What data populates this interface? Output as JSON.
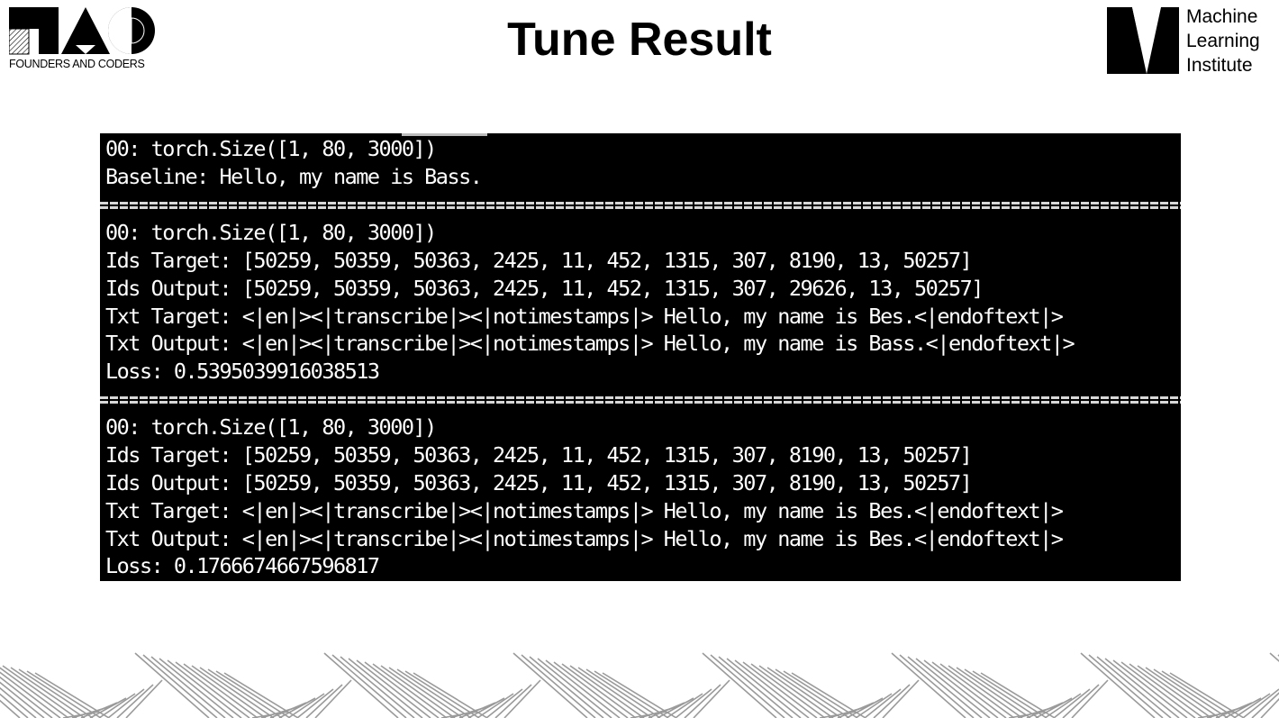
{
  "header": {
    "title": "Tune Result",
    "left_logo_text": "FOUNDERS AND CODERS",
    "right_logo_lines": [
      "Machine",
      "Learning",
      "Institute"
    ]
  },
  "terminal": {
    "blocks": [
      {
        "lines": [
          "00: torch.Size([1, 80, 3000])",
          "Baseline: Hello, my name is Bass."
        ]
      },
      {
        "lines": [
          "00: torch.Size([1, 80, 3000])",
          "Ids Target: [50259, 50359, 50363, 2425, 11, 452, 1315, 307, 8190, 13, 50257]",
          "Ids Output: [50259, 50359, 50363, 2425, 11, 452, 1315, 307, 29626, 13, 50257]",
          "Txt Target: <|en|><|transcribe|><|notimestamps|> Hello, my name is Bes.<|endoftext|>",
          "Txt Output: <|en|><|transcribe|><|notimestamps|> Hello, my name is Bass.<|endoftext|>",
          "Loss: 0.5395039916038513"
        ]
      },
      {
        "lines": [
          "00: torch.Size([1, 80, 3000])",
          "Ids Target: [50259, 50359, 50363, 2425, 11, 452, 1315, 307, 8190, 13, 50257]",
          "Ids Output: [50259, 50359, 50363, 2425, 11, 452, 1315, 307, 8190, 13, 50257]",
          "Txt Target: <|en|><|transcribe|><|notimestamps|> Hello, my name is Bes.<|endoftext|>",
          "Txt Output: <|en|><|transcribe|><|notimestamps|> Hello, my name is Bes.<|endoftext|>",
          "Loss: 0.1766674667596817"
        ]
      }
    ]
  },
  "colors": {
    "terminal_bg": "#000000",
    "terminal_text": "#ffffff",
    "stripe": "#9a9a9a"
  }
}
